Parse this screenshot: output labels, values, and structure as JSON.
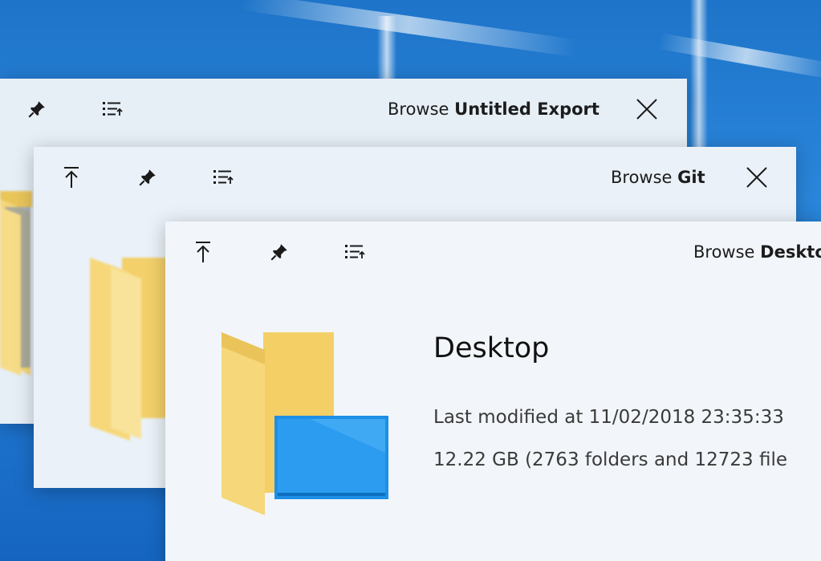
{
  "windows": [
    {
      "title_prefix": "Browse ",
      "title_name": "Untitled Export"
    },
    {
      "title_prefix": "Browse ",
      "title_name": "Git"
    },
    {
      "title_prefix": "Browse ",
      "title_name": "Deskto",
      "details": {
        "folder_name": "Desktop",
        "last_modified": "Last modified at 11/02/2018 23:35:33",
        "size_summary": "12.22 GB (2763 folders and 12723 file"
      }
    }
  ],
  "icons": {
    "up": "arrow-up-icon",
    "pin": "pin-icon",
    "list": "list-icon",
    "close": "close-icon",
    "folder": "folder-icon",
    "desktop_folder": "desktop-folder-icon"
  },
  "colors": {
    "desktop_blue": "#1e74c9",
    "window_bg": "#f2f6fa",
    "folder_yellow": "#f6d77a",
    "desktop_tile_blue": "#1d8fe6"
  }
}
